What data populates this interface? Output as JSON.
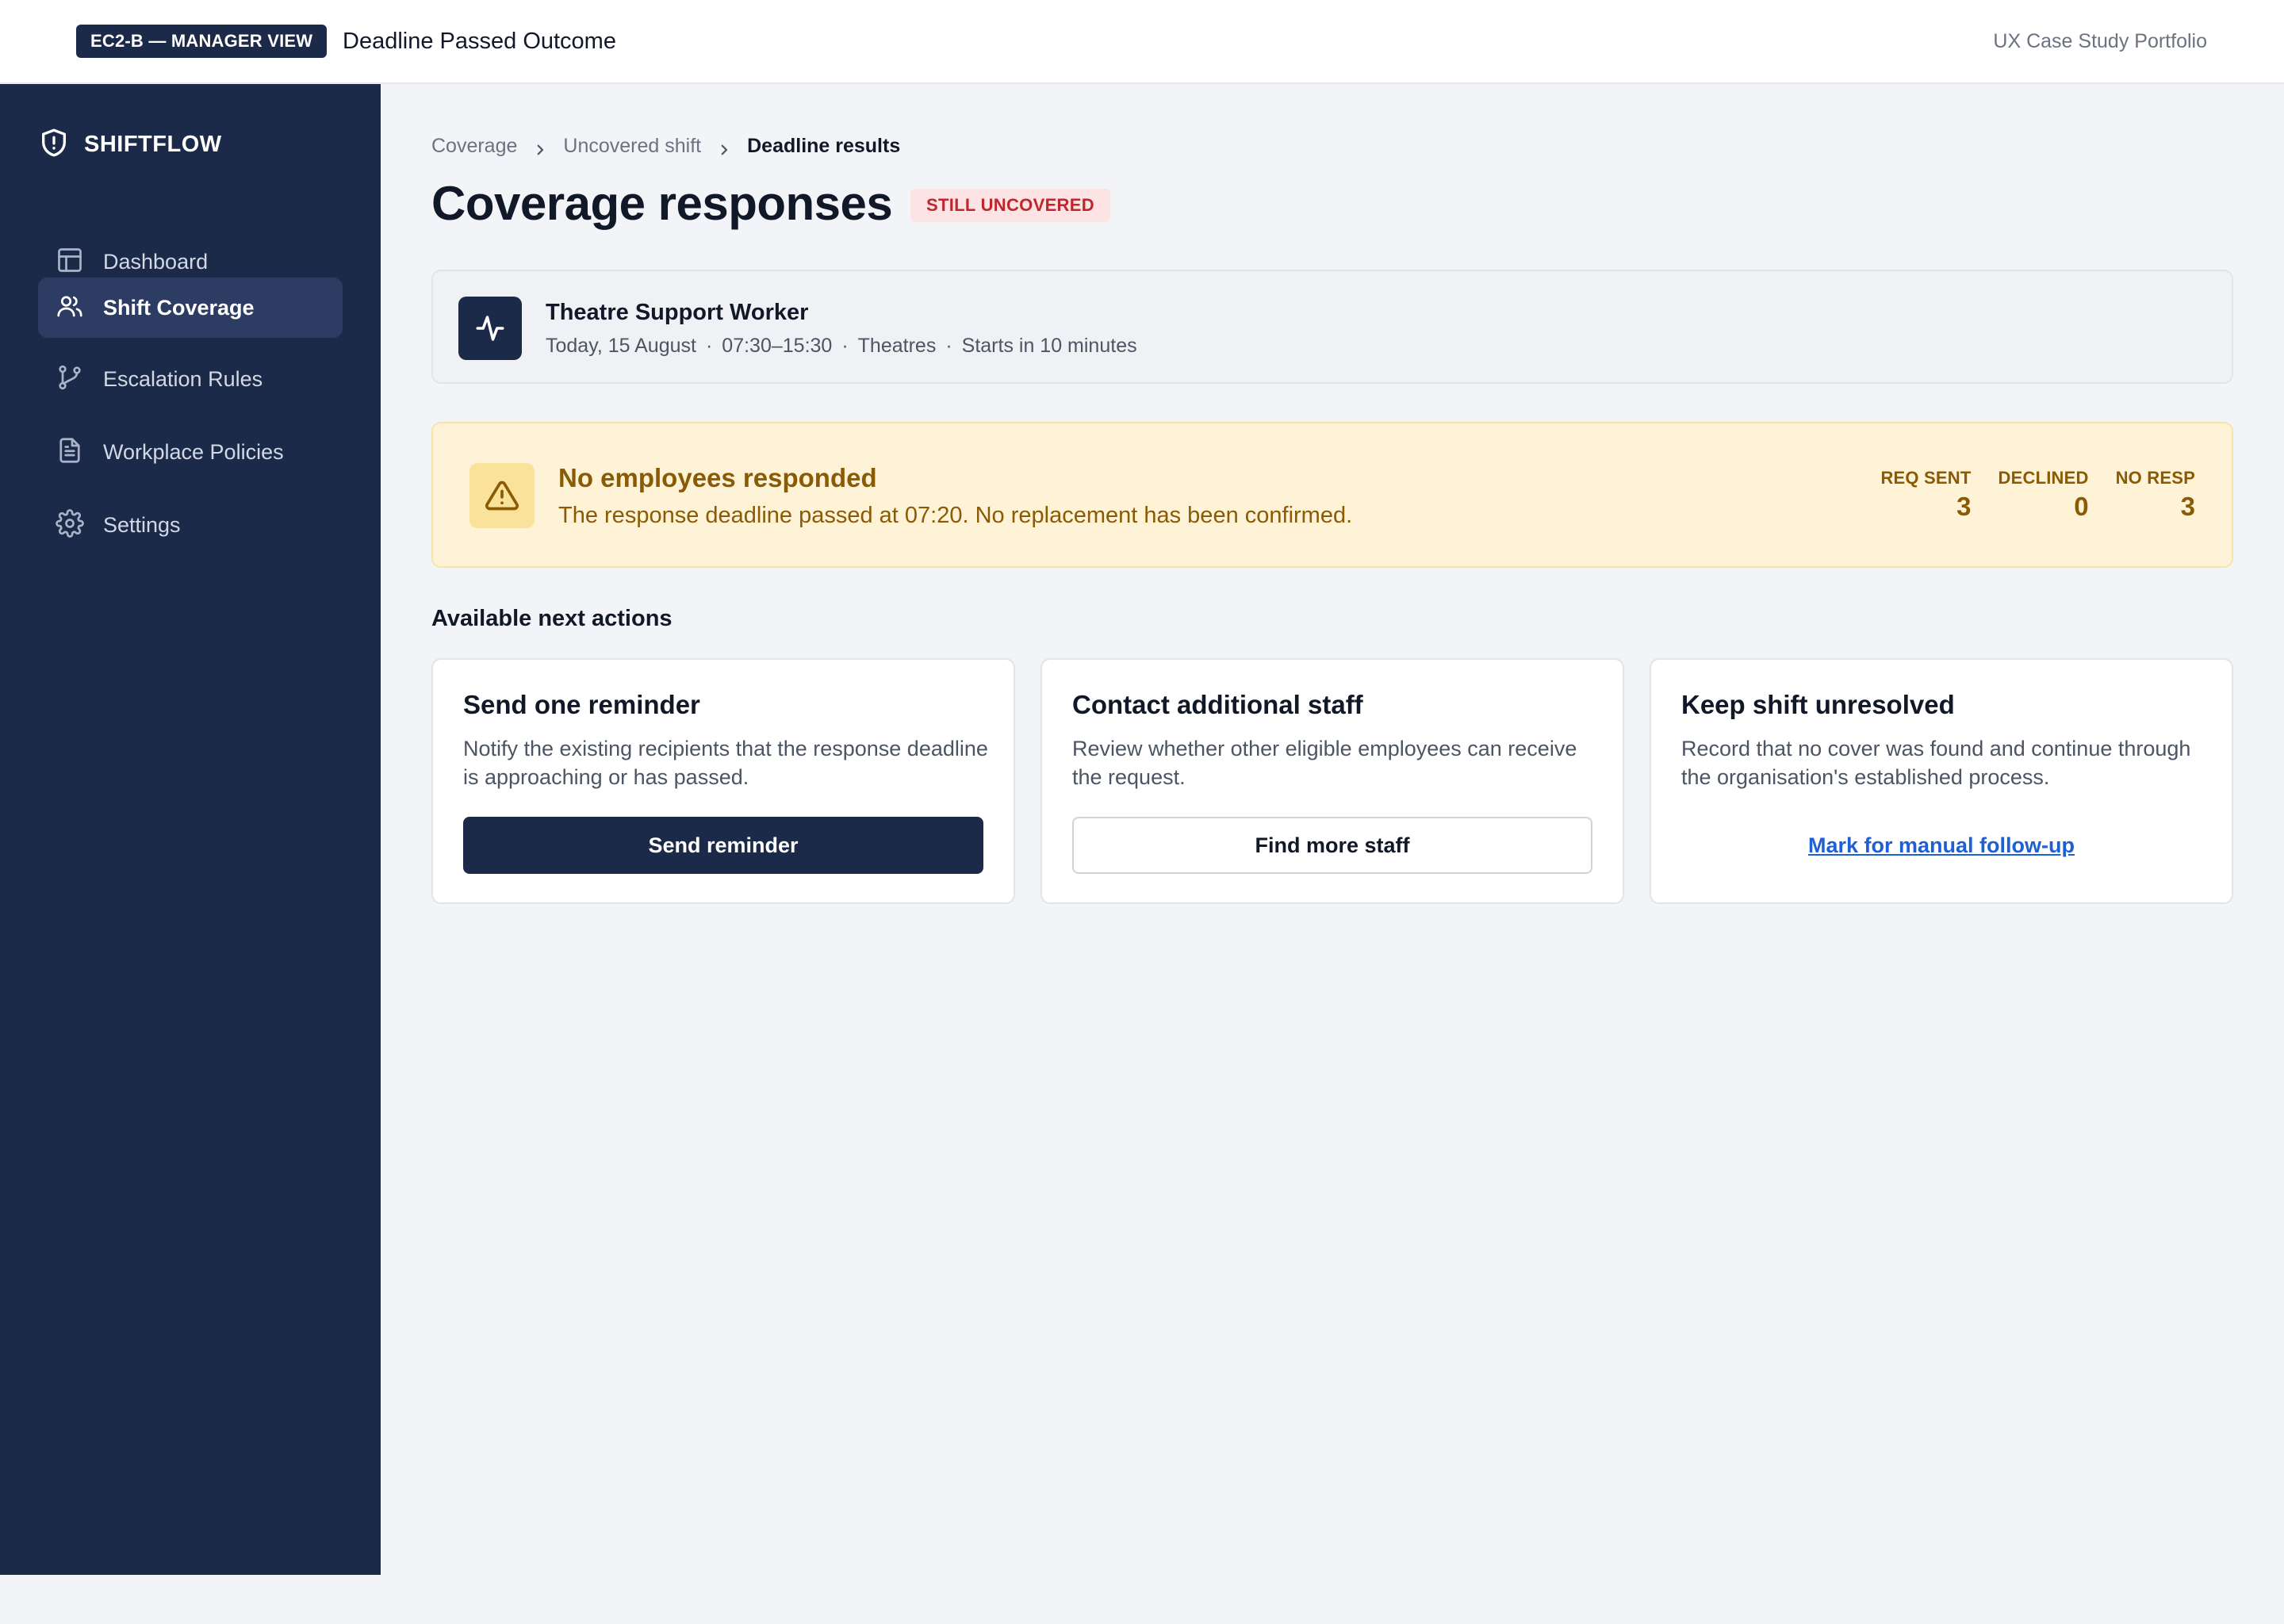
{
  "topbar": {
    "tag": "EC2-B — MANAGER VIEW",
    "title": "Deadline Passed Outcome",
    "portfolio": "UX Case Study Portfolio"
  },
  "sidebar": {
    "brand": "SHIFTFLOW",
    "items": [
      {
        "label": "Dashboard",
        "icon": "layout-icon"
      },
      {
        "label": "Shift Coverage",
        "icon": "users-icon",
        "active": true
      },
      {
        "label": "Escalation Rules",
        "icon": "git-branch-icon"
      },
      {
        "label": "Workplace Policies",
        "icon": "document-icon"
      },
      {
        "label": "Settings",
        "icon": "gear-icon"
      }
    ]
  },
  "breadcrumb": [
    "Coverage",
    "Uncovered shift",
    "Deadline results"
  ],
  "page": {
    "title": "Coverage responses",
    "status_badge": "STILL UNCOVERED"
  },
  "shift": {
    "role": "Theatre Support Worker",
    "date": "Today, 15 August",
    "time": "07:30–15:30",
    "location": "Theatres",
    "starts": "Starts in 10 minutes",
    "separator": "·"
  },
  "alert": {
    "title": "No employees responded",
    "text": "The response deadline passed at 07:20. No replacement has been confirmed.",
    "stats": [
      {
        "label": "REQ SENT",
        "value": "3"
      },
      {
        "label": "DECLINED",
        "value": "0"
      },
      {
        "label": "NO RESP",
        "value": "3"
      }
    ]
  },
  "actions": {
    "section_title": "Available next actions",
    "cards": [
      {
        "title": "Send one reminder",
        "description": "Notify the existing recipients that the response deadline is approaching or has passed.",
        "button": "Send reminder"
      },
      {
        "title": "Contact additional staff",
        "description": "Review whether other eligible employees can receive the request.",
        "button": "Find more staff"
      },
      {
        "title": "Keep shift unresolved",
        "description": "Record that no cover was found and continue through the organisation's established process.",
        "button": "Mark for manual follow-up"
      }
    ]
  },
  "colors": {
    "navy": "#1c2a4a",
    "warning_text": "#8a5a05",
    "warning_bg": "#fef3d6",
    "danger_text": "#c0262d",
    "danger_bg": "#fde3e3",
    "link": "#1f5fd6"
  }
}
